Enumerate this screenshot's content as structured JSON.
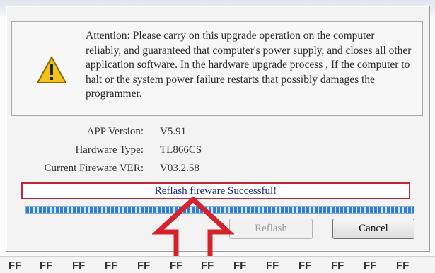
{
  "dialog": {
    "warning_text": "Attention: Please  carry on this upgrade operation on the computer reliably, and guaranteed that computer's power supply, and closes all other application software. In the hardware upgrade process , If the computer to halt or the system power failure restarts that possibly damages the programmer.",
    "warning_icon": "warning-icon",
    "info": [
      {
        "label": "APP Version:",
        "value": "V5.91"
      },
      {
        "label": "Hardware Type:",
        "value": "TL866CS"
      },
      {
        "label": "Current Fireware VER:",
        "value": "V03.2.58"
      }
    ],
    "status": "Reflash fireware Successful!",
    "progress_percent": 100,
    "buttons": {
      "reflash": "Reflash",
      "cancel": "Cancel"
    }
  },
  "hex_strip": {
    "cells": [
      "FF",
      "FF",
      "FF",
      "FF",
      "FF",
      "FF",
      "FF",
      "FF",
      "FF",
      "FF",
      "FF",
      "FF",
      "FF"
    ]
  },
  "colors": {
    "status_border": "#c0283a",
    "status_text": "#1a2a8a",
    "progress": "#2f7fd6",
    "arrow": "#d4232c"
  }
}
